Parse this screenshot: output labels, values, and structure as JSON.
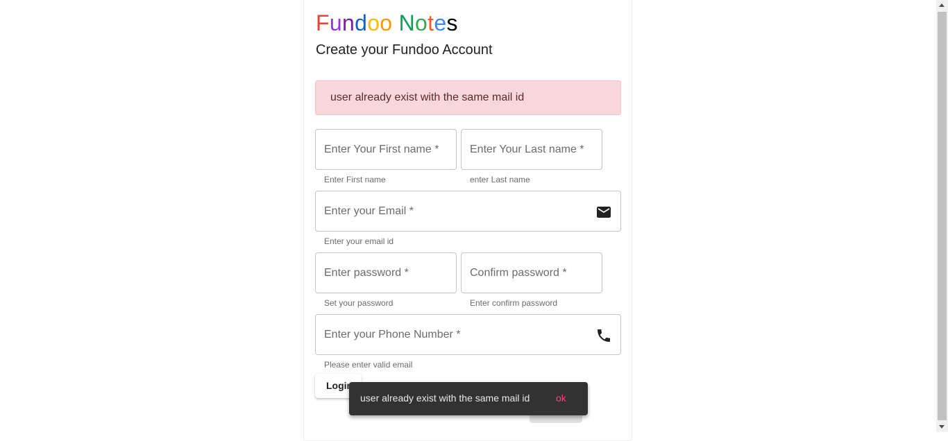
{
  "logo": {
    "letters": [
      {
        "ch": "F",
        "color": "#ea4335"
      },
      {
        "ch": "u",
        "color": "#9334e6"
      },
      {
        "ch": "n",
        "color": "#7b1fa2"
      },
      {
        "ch": "d",
        "color": "#1565c0"
      },
      {
        "ch": "o",
        "color": "#fbbc04"
      },
      {
        "ch": "o",
        "color": "#ff9800"
      },
      {
        "ch": " ",
        "color": "#000000"
      },
      {
        "ch": "N",
        "color": "#0f9d58"
      },
      {
        "ch": "o",
        "color": "#34a853"
      },
      {
        "ch": "t",
        "color": "#ff5722"
      },
      {
        "ch": "e",
        "color": "#4285f4"
      },
      {
        "ch": "s",
        "color": "#000000"
      }
    ]
  },
  "subtitle": "Create your Fundoo Account",
  "alert": {
    "message": "user already exist with the same mail id"
  },
  "form": {
    "first_name": {
      "placeholder": "Enter Your First name *",
      "helper": "Enter First name"
    },
    "last_name": {
      "placeholder": "Enter Your Last name *",
      "helper": "enter Last name"
    },
    "email": {
      "placeholder": "Enter your Email *",
      "helper": "Enter your email id",
      "icon": "mail-icon"
    },
    "password": {
      "placeholder": "Enter password *",
      "helper": "Set your password"
    },
    "confirm_password": {
      "placeholder": "Confirm password *",
      "helper": "Enter confirm password"
    },
    "phone": {
      "placeholder": "Enter your Phone Number *",
      "helper": "Please enter valid email",
      "icon": "phone-icon"
    }
  },
  "buttons": {
    "login_label": "Login"
  },
  "snackbar": {
    "message": "user already exist with the same mail id",
    "action": "ok"
  },
  "colors": {
    "alert_bg": "#f8d7da",
    "snackbar_bg": "#323232",
    "snackbar_action": "#ff4081"
  }
}
